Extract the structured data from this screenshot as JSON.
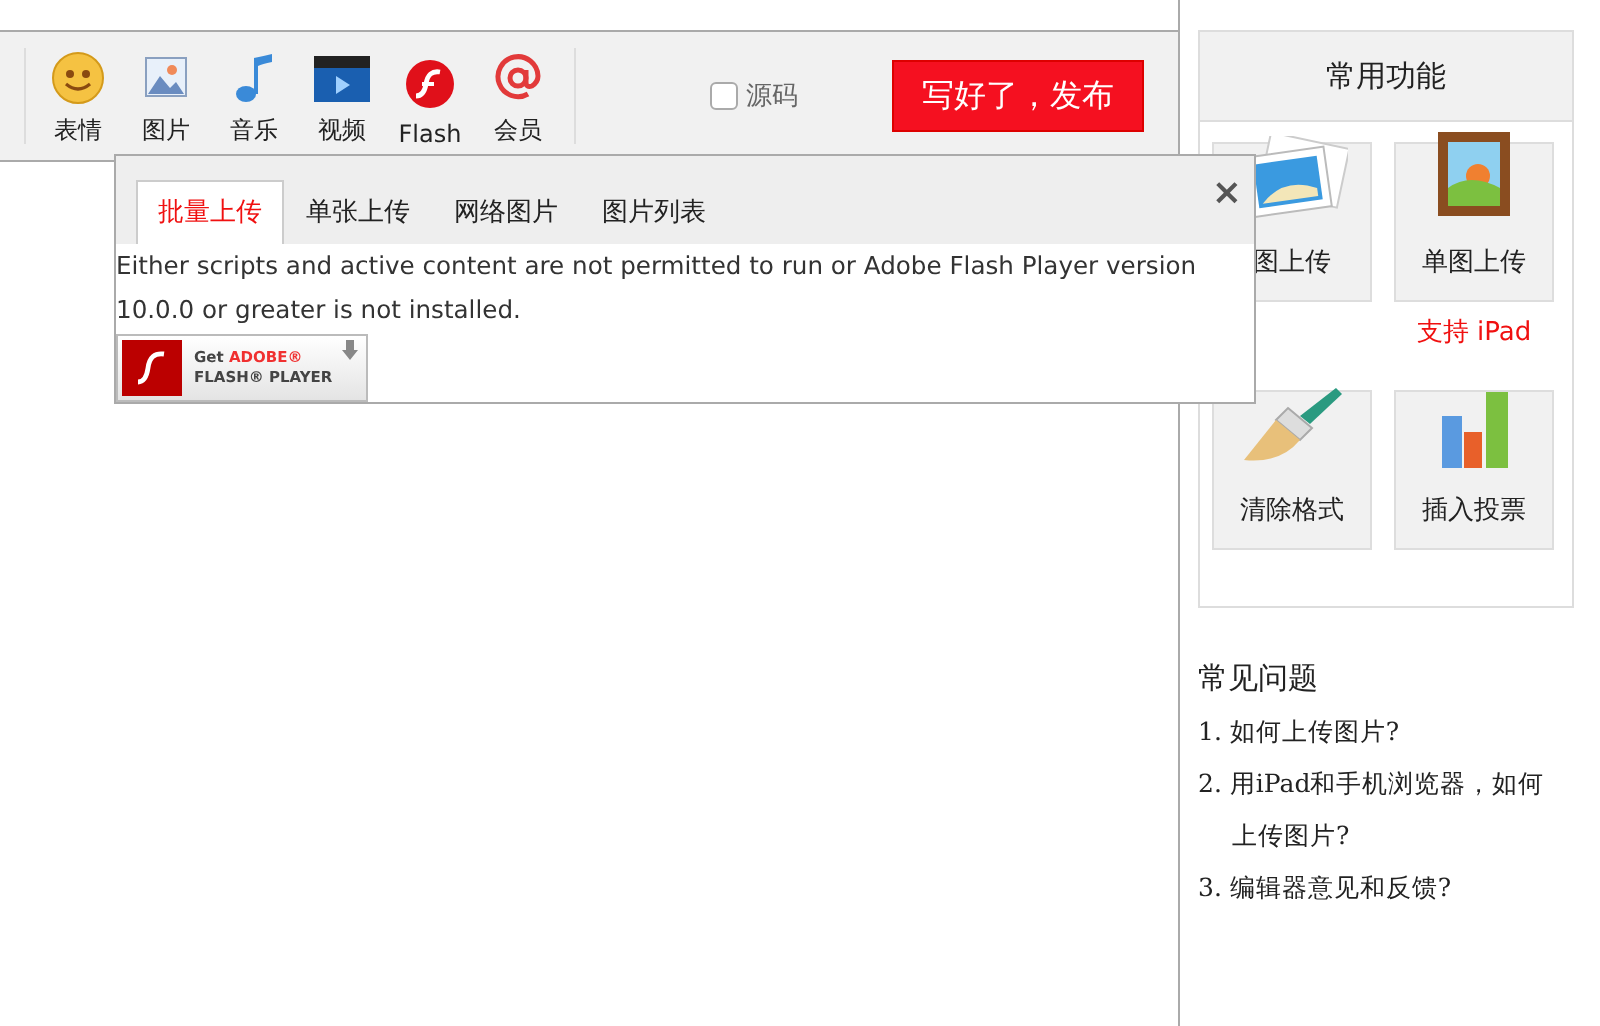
{
  "toolbar": {
    "tools": [
      {
        "kind": "smiley",
        "label": "表情"
      },
      {
        "kind": "image",
        "label": "图片"
      },
      {
        "kind": "music",
        "label": "音乐"
      },
      {
        "kind": "video",
        "label": "视频"
      },
      {
        "kind": "flash",
        "label": "Flash"
      },
      {
        "kind": "at",
        "label": "会员"
      }
    ],
    "source_checkbox": {
      "label": "源码",
      "checked": false
    },
    "publish_button": "写好了，发布"
  },
  "upload_dialog": {
    "tabs": [
      {
        "label": "批量上传",
        "selected": true
      },
      {
        "label": "单张上传",
        "selected": false
      },
      {
        "label": "网络图片",
        "selected": false
      },
      {
        "label": "图片列表",
        "selected": false
      }
    ],
    "close": "×",
    "message": "Either scripts and active content are not permitted to run or Adobe Flash Player version 10.0.0 or greater is not installed.",
    "get_flash": {
      "prefix": "Get",
      "brand": "ADOBE®",
      "product": "FLASH® PLAYER"
    }
  },
  "sidebar": {
    "title": "常用功能",
    "tiles": [
      {
        "kind": "photos",
        "label": "图上传"
      },
      {
        "kind": "frame",
        "label": "单图上传",
        "note": "支持 iPad"
      },
      {
        "kind": "brush",
        "label": "清除格式"
      },
      {
        "kind": "bars",
        "label": "插入投票"
      }
    ]
  },
  "faq": {
    "title": "常见问题",
    "items": [
      "1. 如何上传图片?",
      "2. 用iPad和手机浏览器，如何上传图片?",
      "3. 编辑器意见和反馈?"
    ]
  }
}
